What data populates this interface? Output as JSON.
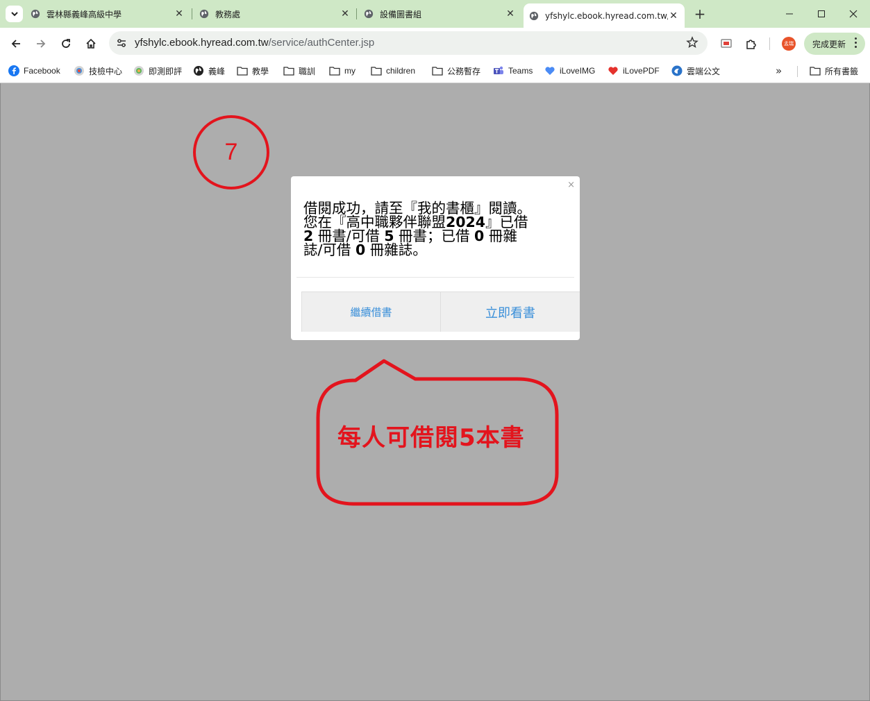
{
  "tabs": [
    {
      "label": "雲林縣義峰高級中學",
      "active": false
    },
    {
      "label": "教務處",
      "active": false
    },
    {
      "label": "設備圖書組",
      "active": false
    },
    {
      "label": "yfshylc.ebook.hyread.com.tw/",
      "active": true
    }
  ],
  "address_bar": {
    "host": "yfshylc.ebook.hyread.com.tw",
    "path": "/service/authCenter.jsp"
  },
  "toolbar": {
    "profile_initials": "孟瑞",
    "update_label": "完成更新"
  },
  "bookmarks": [
    {
      "label": "Facebook",
      "icon": "facebook-icon"
    },
    {
      "label": "技檢中心",
      "icon": "site-icon"
    },
    {
      "label": "即測即評",
      "icon": "site-icon"
    },
    {
      "label": "義峰",
      "icon": "globe-icon"
    },
    {
      "label": "教學",
      "icon": "folder-icon"
    },
    {
      "label": "職訓",
      "icon": "folder-icon"
    },
    {
      "label": "my",
      "icon": "folder-icon"
    },
    {
      "label": "children",
      "icon": "folder-icon"
    },
    {
      "label": "公務暫存",
      "icon": "folder-icon"
    },
    {
      "label": "Teams",
      "icon": "teams-icon"
    },
    {
      "label": "iLoveIMG",
      "icon": "heart-icon"
    },
    {
      "label": "iLovePDF",
      "icon": "heart-icon"
    },
    {
      "label": "雲端公文",
      "icon": "site-icon"
    }
  ],
  "bookmarks_all_label": "所有書籤",
  "annotation": {
    "step_number": "7",
    "bubble_text": "每人可借閱5本書"
  },
  "modal": {
    "line1": "借閱成功，請至『我的書櫃』閱讀。",
    "line2_pre": "您在『高中職夥伴聯盟",
    "line2_year": "2024",
    "line2_post": "』已借",
    "books_borrowed": "2",
    "books_word1": " 冊書/可借 ",
    "books_limit": "5",
    "books_word2": " 冊書；已借 ",
    "mags_borrowed": "0",
    "mags_word1": " 冊雜",
    "mags_word2": "誌/可借 ",
    "mags_limit": "0",
    "mags_word3": " 冊雜誌。",
    "continue_label": "繼續借書",
    "read_now_label": "立即看書",
    "close": "×"
  },
  "colors": {
    "tabstrip": "#cfe8c6",
    "page_bg": "#adadad",
    "annotation_red": "#e3141d",
    "modal_button_text": "#3a8fd9"
  }
}
